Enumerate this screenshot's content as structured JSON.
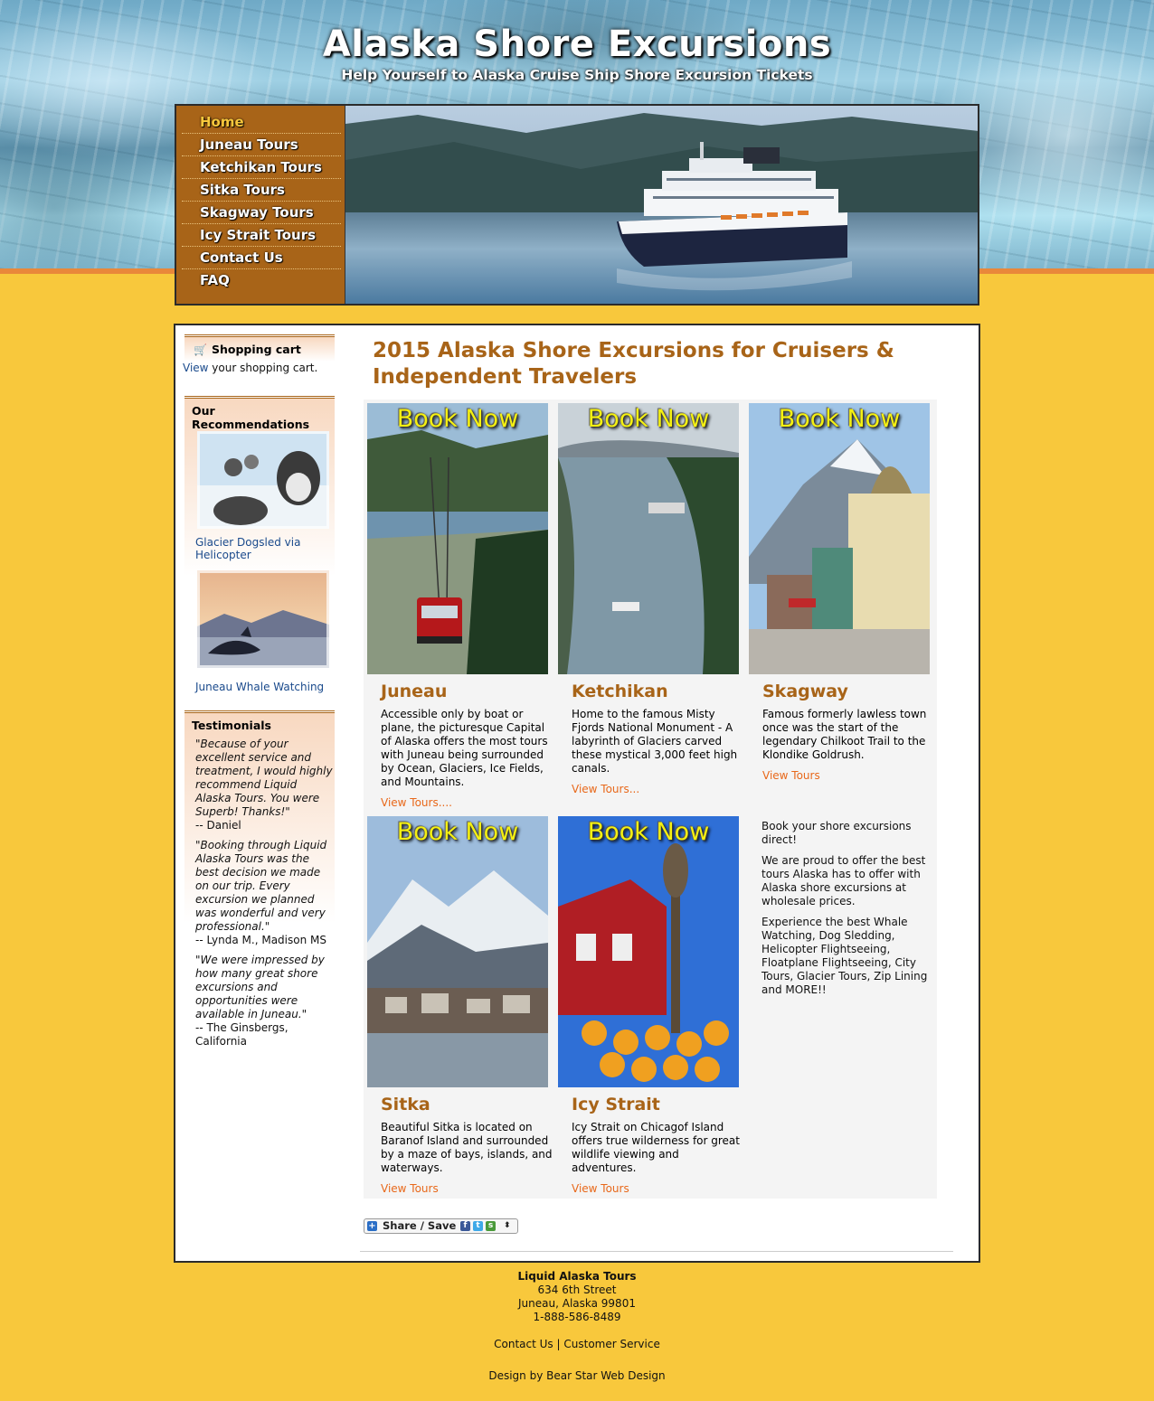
{
  "header": {
    "title": "Alaska Shore Excursions",
    "tagline": "Help Yourself to Alaska Cruise Ship Shore Excursion Tickets"
  },
  "nav": {
    "items": [
      "Home",
      "Juneau Tours",
      "Ketchikan Tours",
      "Sitka Tours",
      "Skagway Tours",
      "Icy Strait Tours",
      "Contact Us",
      "FAQ"
    ],
    "active": "Home"
  },
  "sidebar": {
    "cart": {
      "title": "Shopping cart",
      "link": "View",
      "text": " your shopping cart."
    },
    "recommendations": {
      "title": "Our Recommendations",
      "items": [
        "Glacier Dogsled via Helicopter",
        "Juneau Whale Watching"
      ]
    },
    "testimonials": {
      "title": "Testimonials",
      "items": [
        {
          "quote": "\"Because of your excellent service and treatment, I would highly recommend Liquid Alaska Tours. You were Superb! Thanks!\"",
          "author": "-- Daniel"
        },
        {
          "quote": "\"Booking through Liquid Alaska Tours was the best decision we made on our trip. Every excursion we planned was wonderful and very professional.\"",
          "author": "-- Lynda M., Madison MS"
        },
        {
          "quote": "\"We were impressed by how many great shore excursions and opportunities were available in Juneau.\"",
          "author": "-- The Ginsbergs, California"
        }
      ]
    }
  },
  "main": {
    "title": "2015 Alaska Shore Excursions for Cruisers & Independent Travelers",
    "book_now": "Book Now",
    "tours": [
      {
        "name": "Juneau",
        "desc": "Accessible only by boat or plane, the picturesque Capital of Alaska offers the most tours with Juneau being surrounded by Ocean, Glaciers, Ice Fields, and Mountains.",
        "link": "View Tours...."
      },
      {
        "name": "Ketchikan",
        "desc": "Home to the famous Misty Fjords National Monument - A labyrinth of Glaciers carved these mystical 3,000 feet high canals.",
        "link": "View Tours..."
      },
      {
        "name": "Skagway",
        "desc": "Famous formerly lawless town once was the start of the legendary Chilkoot Trail to the Klondike Goldrush.",
        "link": "View Tours"
      },
      {
        "name": "Sitka",
        "desc": "Beautiful Sitka is located on Baranof Island and surrounded by a maze of bays, islands, and waterways.",
        "link": "View Tours"
      },
      {
        "name": "Icy Strait",
        "desc": "Icy Strait on Chicagof Island offers true wilderness for great wildlife viewing and adventures.",
        "link": "View Tours"
      }
    ],
    "promo": [
      "Book your shore excursions direct!",
      "We are proud to offer the best tours Alaska has to offer with Alaska shore excursions at wholesale prices.",
      "Experience the best Whale Watching, Dog Sledding, Helicopter Flightseeing, Floatplane Flightseeing, City Tours, Glacier Tours, Zip Lining and MORE!!"
    ],
    "share_label": "Share / Save"
  },
  "footer": {
    "company": "Liquid Alaska Tours",
    "street": "634 6th Street",
    "city": "Juneau, Alaska 99801",
    "phone": "1-888-586-8489",
    "contact": "Contact Us",
    "separator": "|",
    "service": "Customer Service",
    "credit": "Design by Bear Star Web Design"
  },
  "colors": {
    "background": "#f8c83c",
    "accent_brown": "#a86418",
    "link_orange": "#e8681a",
    "book_now_yellow": "#f4f012"
  }
}
